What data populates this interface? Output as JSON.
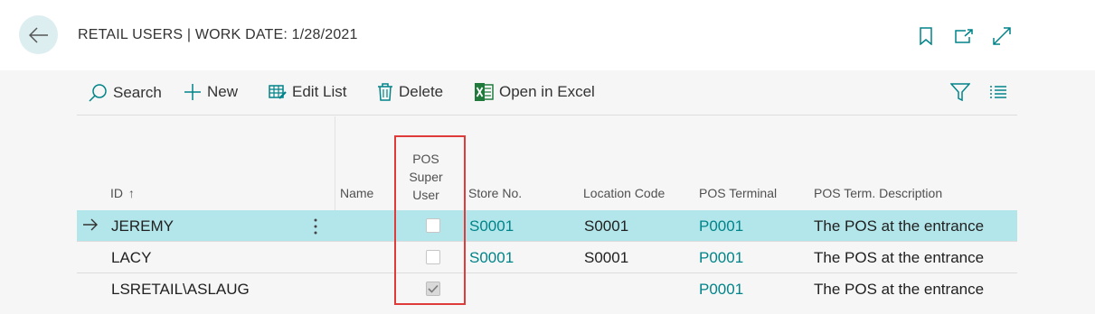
{
  "header": {
    "title": "RETAIL USERS | WORK DATE: 1/28/2021",
    "icons": [
      "back-arrow-icon",
      "bookmark-icon",
      "open-new-window-icon",
      "expand-icon"
    ]
  },
  "actions": {
    "search": "Search",
    "new": "New",
    "edit_list": "Edit List",
    "delete": "Delete",
    "open_in_excel": "Open in Excel"
  },
  "columns": {
    "id": "ID",
    "name": "Name",
    "pos_super_user_1": "POS",
    "pos_super_user_2": "Super",
    "pos_super_user_3": "User",
    "store_no": "Store No.",
    "location_code": "Location Code",
    "pos_terminal": "POS Terminal",
    "pos_term_description": "POS Term. Description"
  },
  "sort": {
    "column": "ID",
    "direction": "ascending",
    "indicator": "↑"
  },
  "rows": [
    {
      "id": "JEREMY",
      "name": "",
      "pos_super_user": false,
      "store_no": "S0001",
      "location_code": "S0001",
      "pos_terminal": "P0001",
      "pos_term_description": "The POS at the entrance",
      "selected": true
    },
    {
      "id": "LACY",
      "name": "",
      "pos_super_user": false,
      "store_no": "S0001",
      "location_code": "S0001",
      "pos_terminal": "P0001",
      "pos_term_description": "The POS at the entrance",
      "selected": false
    },
    {
      "id": "LSRETAIL\\ASLAUG",
      "name": "",
      "pos_super_user": true,
      "store_no": "",
      "location_code": "",
      "pos_terminal": "P0001",
      "pos_term_description": "The POS at the entrance",
      "selected": false
    }
  ],
  "colors": {
    "accent": "#008489",
    "selected_row": "#b3e6ea",
    "highlight_box": "#e03b3b"
  }
}
